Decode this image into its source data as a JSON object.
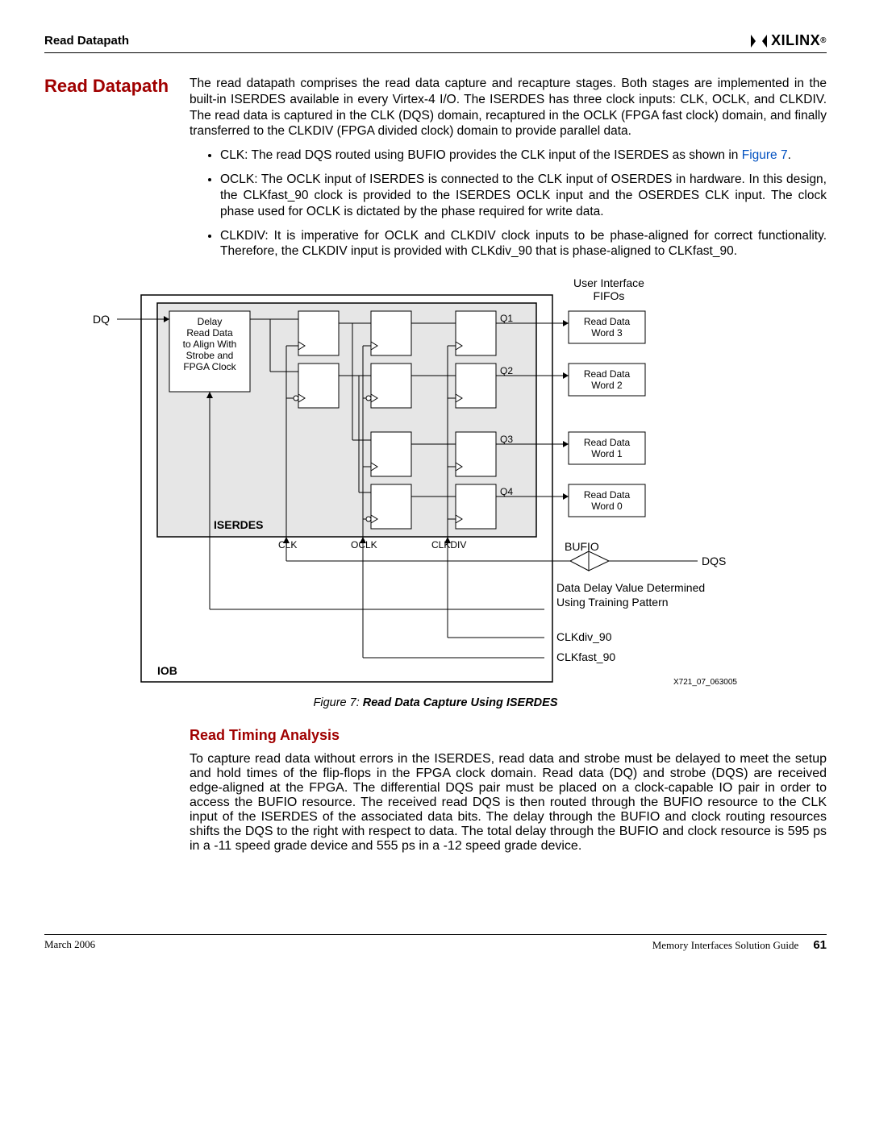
{
  "header": {
    "section": "Read Datapath",
    "brand": "XILINX"
  },
  "heading": "Read Datapath",
  "intro": "The read datapath comprises the read data capture and recapture stages. Both stages are implemented in the built-in ISERDES available in every Virtex-4 I/O. The ISERDES has three clock inputs: CLK, OCLK, and CLKDIV. The read data is captured in the CLK (DQS) domain, recaptured in the OCLK (FPGA fast clock) domain, and finally transferred to the CLKDIV (FPGA divided clock) domain to provide parallel data.",
  "bullets": {
    "clk_a": "CLK: The read DQS routed using BUFIO provides the CLK input of the ISERDES as shown in ",
    "clk_link": "Figure 7",
    "clk_b": ".",
    "oclk": "OCLK: The OCLK input of ISERDES is connected to the CLK input of OSERDES in hardware. In this design, the CLKfast_90 clock is provided to the ISERDES OCLK input and the OSERDES CLK input. The clock phase used for OCLK is dictated by the phase required for write data.",
    "clkdiv": "CLKDIV: It is imperative for OCLK and CLKDIV clock inputs to be phase-aligned for correct functionality. Therefore, the CLKDIV input is provided with CLKdiv_90 that is phase-aligned to CLKfast_90."
  },
  "diagram": {
    "dq": "DQ",
    "delay_l1": "Delay",
    "delay_l2": "Read Data",
    "delay_l3": "to Align With",
    "delay_l4": "Strobe and",
    "delay_l5": "FPGA Clock",
    "iserdes": "ISERDES",
    "iob": "IOB",
    "clk": "CLK",
    "oclk": "OCLK",
    "clkdiv": "CLKDIV",
    "q1": "Q1",
    "q2": "Q2",
    "q3": "Q3",
    "q4": "Q4",
    "ui_l1": "User Interface",
    "ui_l2": "FIFOs",
    "fifo3_l1": "Read Data",
    "fifo3_l2": "Word 3",
    "fifo2_l1": "Read Data",
    "fifo2_l2": "Word 2",
    "fifo1_l1": "Read Data",
    "fifo1_l2": "Word 1",
    "fifo0_l1": "Read Data",
    "fifo0_l2": "Word 0",
    "bufio": "BUFIO",
    "dqs": "DQS",
    "train_l1": "Data Delay Value Determined",
    "train_l2": "Using Training Pattern",
    "clkdiv90": "CLKdiv_90",
    "clkfast90": "CLKfast_90",
    "figid": "X721_07_063005"
  },
  "caption_prefix": "Figure 7:",
  "caption_bold": "Read Data Capture Using ISERDES",
  "h3": "Read Timing Analysis",
  "timing_para": "To capture read data without errors in the ISERDES, read data and strobe must be delayed to meet the setup and hold times of the flip-flops in the FPGA clock domain. Read data (DQ) and strobe (DQS) are received edge-aligned at the FPGA. The differential DQS pair must be placed on a clock-capable IO pair in order to access the BUFIO resource. The received read DQS is then routed through the BUFIO resource to the CLK input of the ISERDES of the associated data bits. The delay through the BUFIO and clock routing resources shifts the DQS to the right with respect to data. The total delay through the BUFIO and clock resource is 595 ps in a -11 speed grade device and 555 ps in a -12 speed grade device.",
  "footer": {
    "date": "March 2006",
    "guide": "Memory Interfaces Solution Guide",
    "page": "61"
  }
}
